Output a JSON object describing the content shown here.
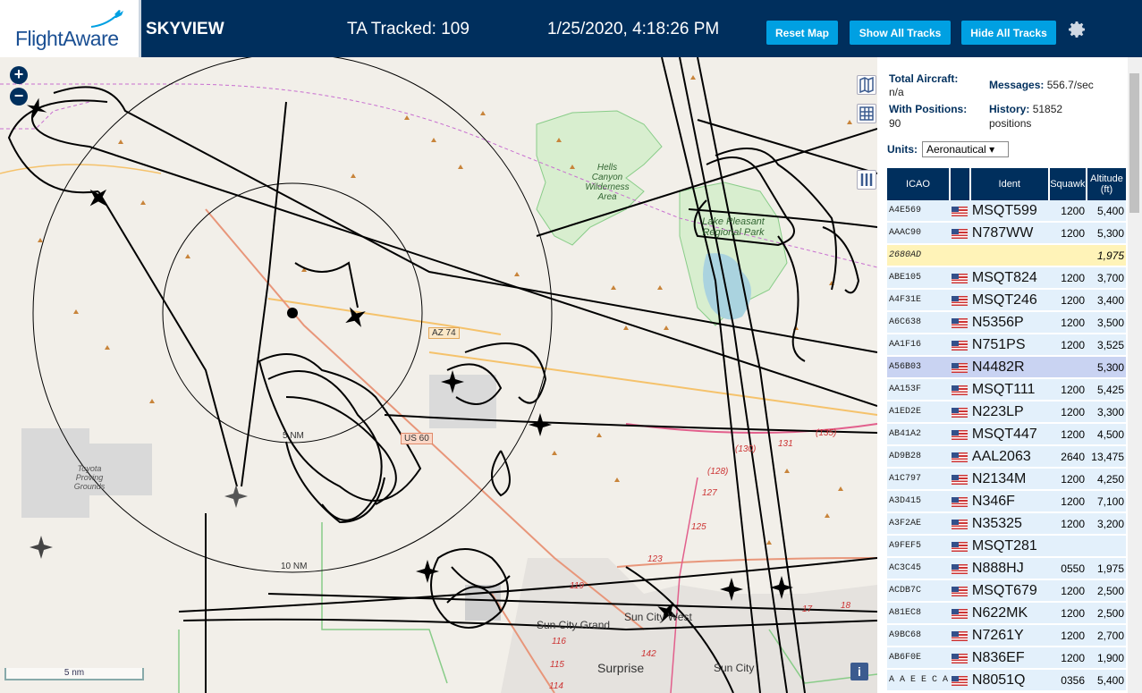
{
  "header": {
    "logo": "FlightAware",
    "title": "SKYVIEW",
    "ta_tracked": "TA Tracked: 109",
    "datetime": "1/25/2020, 4:18:26 PM",
    "buttons": {
      "reset": "Reset Map",
      "show": "Show All Tracks",
      "hide": "Hide All Tracks"
    }
  },
  "map": {
    "labels": {
      "hells_canyon": "Hells Canyon Wilderness Area",
      "lake_pleasant": "Lake Pleasant Regional Park",
      "toyota": "Toyota Proving Grounds",
      "az74": "AZ 74",
      "us60": "US 60",
      "ring5": "5 NM",
      "ring10": "10 NM",
      "sun_city_grand": "Sun City Grand",
      "sun_city_west": "Sun City West",
      "sun_city": "Sun City",
      "surprise": "Surprise",
      "r130": "(130)",
      "r131": "131",
      "r135": "(135)",
      "r128": "(128)",
      "r127": "127",
      "r125": "125",
      "r123": "123",
      "r119": "119",
      "r116": "116",
      "r115": "115",
      "r114": "114",
      "r142": "142",
      "r17": "17",
      "r18": "18"
    },
    "scale": "5 nm",
    "zoom_in": "+",
    "zoom_out": "−",
    "info": "i"
  },
  "sidebar": {
    "total_aircraft_label": "Total Aircraft:",
    "total_aircraft_value": "n/a",
    "with_positions_label": "With Positions:",
    "with_positions_value": "90",
    "messages_label": "Messages:",
    "messages_value": "556.7/sec",
    "history_label": "History:",
    "history_value": "51852",
    "history_unit": "positions",
    "units_label": "Units:",
    "units_value": "Aeronautical",
    "columns": [
      "ICAO",
      "",
      "Ident",
      "Squawk",
      "Altitude (ft)"
    ],
    "rows": [
      {
        "icao": "A4E569",
        "ident": "MSQT599",
        "squawk": "1200",
        "alt": "5,400"
      },
      {
        "icao": "AAAC90",
        "ident": "N787WW",
        "squawk": "1200",
        "alt": "5,300"
      },
      {
        "icao": "2680AD",
        "ident": "",
        "squawk": "",
        "alt": "1,975"
      },
      {
        "icao": "ABE105",
        "ident": "MSQT824",
        "squawk": "1200",
        "alt": "3,700"
      },
      {
        "icao": "A4F31E",
        "ident": "MSQT246",
        "squawk": "1200",
        "alt": "3,400"
      },
      {
        "icao": "A6C638",
        "ident": "N5356P",
        "squawk": "1200",
        "alt": "3,500"
      },
      {
        "icao": "AA1F16",
        "ident": "N751PS",
        "squawk": "1200",
        "alt": "3,525"
      },
      {
        "icao": "A56B03",
        "ident": "N4482R",
        "squawk": "",
        "alt": "5,300"
      },
      {
        "icao": "AA153F",
        "ident": "MSQT111",
        "squawk": "1200",
        "alt": "5,425"
      },
      {
        "icao": "A1ED2E",
        "ident": "N223LP",
        "squawk": "1200",
        "alt": "3,300"
      },
      {
        "icao": "AB41A2",
        "ident": "MSQT447",
        "squawk": "1200",
        "alt": "4,500"
      },
      {
        "icao": "AD9B28",
        "ident": "AAL2063",
        "squawk": "2640",
        "alt": "13,475"
      },
      {
        "icao": "A1C797",
        "ident": "N2134M",
        "squawk": "1200",
        "alt": "4,250"
      },
      {
        "icao": "A3D415",
        "ident": "N346F",
        "squawk": "1200",
        "alt": "7,100"
      },
      {
        "icao": "A3F2AE",
        "ident": "N35325",
        "squawk": "1200",
        "alt": "3,200"
      },
      {
        "icao": "A9FEF5",
        "ident": "MSQT281",
        "squawk": "",
        "alt": ""
      },
      {
        "icao": "AC3C45",
        "ident": "N888HJ",
        "squawk": "0550",
        "alt": "1,975"
      },
      {
        "icao": "ACDB7C",
        "ident": "MSQT679",
        "squawk": "1200",
        "alt": "2,500"
      },
      {
        "icao": "A81EC8",
        "ident": "N622MK",
        "squawk": "1200",
        "alt": "2,500"
      },
      {
        "icao": "A9BC68",
        "ident": "N7261Y",
        "squawk": "1200",
        "alt": "2,700"
      },
      {
        "icao": "AB6F0E",
        "ident": "N836EF",
        "squawk": "1200",
        "alt": "1,900"
      },
      {
        "icao": "A A E E C A",
        "ident": "N8051Q",
        "squawk": "0356",
        "alt": "5,400"
      }
    ]
  }
}
